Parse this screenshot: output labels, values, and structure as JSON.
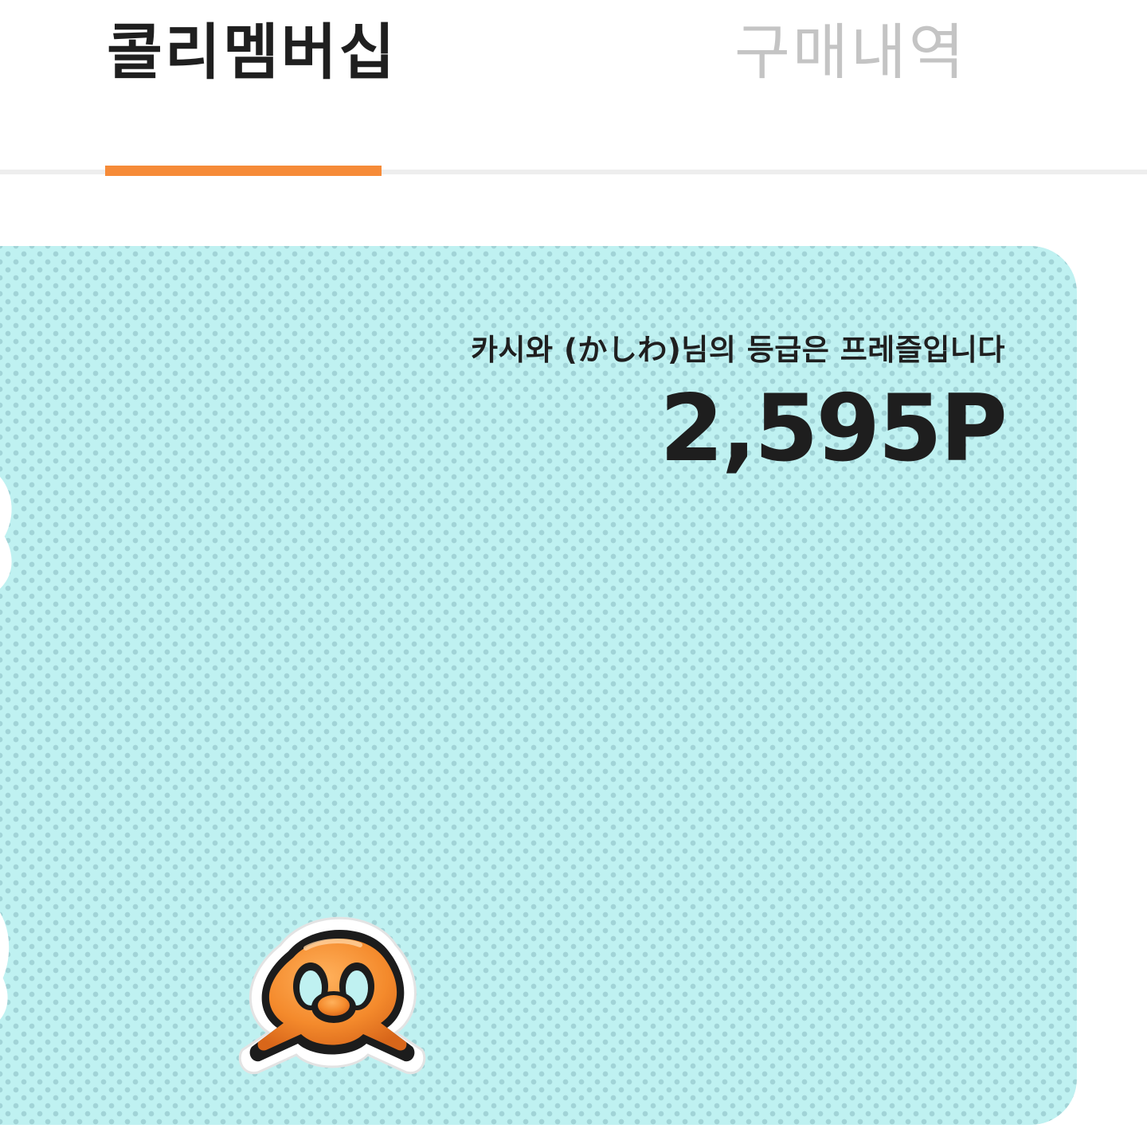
{
  "tabs": [
    {
      "label": "콜리멤버십",
      "active": true
    },
    {
      "label": "구매내역",
      "active": false
    }
  ],
  "colors": {
    "accent": "#f68b38",
    "card_bg": "#bff1f1",
    "text_dark": "#1f1f1f",
    "tab_inactive": "#c4c4c4"
  },
  "membership_card": {
    "greeting": "카시와 (かしわ)님의 등급은 프레즐입니다",
    "points": "2,595P",
    "grade_icon": "pretzel-icon"
  }
}
